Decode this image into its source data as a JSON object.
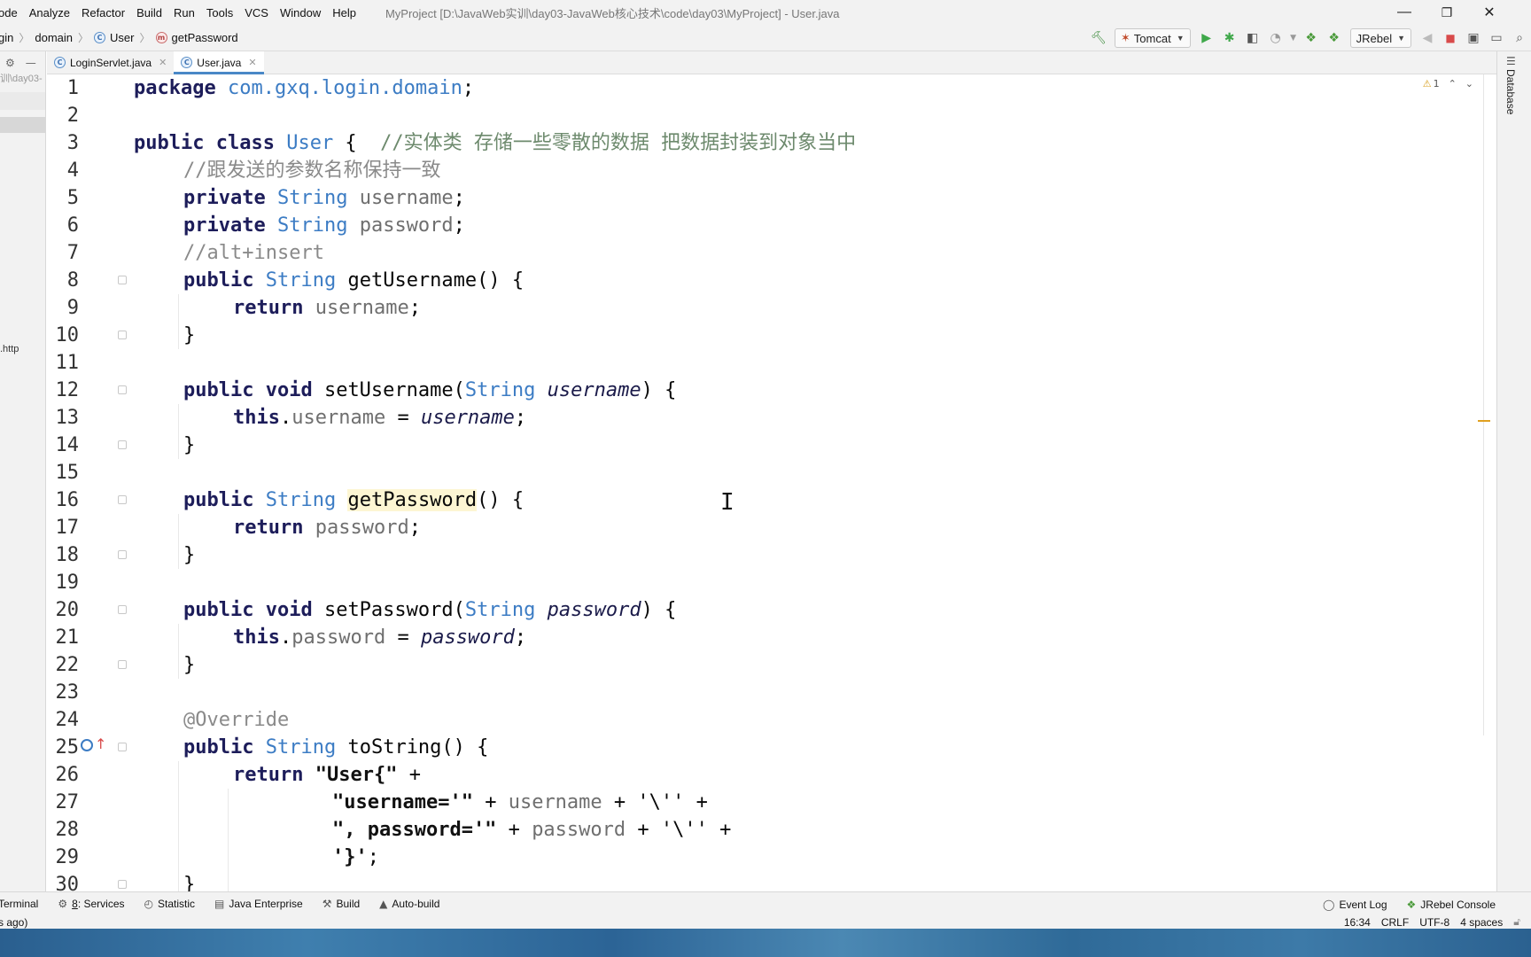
{
  "menu": {
    "items": [
      "ode",
      "Analyze",
      "Refactor",
      "Build",
      "Run",
      "Tools",
      "VCS",
      "Window",
      "Help"
    ],
    "title": "MyProject [D:\\JavaWeb实训\\day03-JavaWeb核心技术\\code\\day03\\MyProject] - User.java",
    "window_controls": [
      "—",
      "❐",
      "✕"
    ]
  },
  "breadcrumb": {
    "items": [
      "gin",
      "domain",
      "User",
      "getPassword"
    ]
  },
  "toolbar": {
    "run_config": "Tomcat",
    "jrebel": "JRebel"
  },
  "leftstrip": {
    "path_hint": "训\\day03-",
    "file_hint": ".http"
  },
  "tabs": [
    {
      "label": "LoginServlet.java",
      "active": false
    },
    {
      "label": "User.java",
      "active": true
    }
  ],
  "editor": {
    "warning_count": "1",
    "lines": [
      {
        "n": "1"
      },
      {
        "n": "2"
      },
      {
        "n": "3"
      },
      {
        "n": "4"
      },
      {
        "n": "5"
      },
      {
        "n": "6"
      },
      {
        "n": "7"
      },
      {
        "n": "8"
      },
      {
        "n": "9"
      },
      {
        "n": "10"
      },
      {
        "n": "11"
      },
      {
        "n": "12"
      },
      {
        "n": "13"
      },
      {
        "n": "14"
      },
      {
        "n": "15"
      },
      {
        "n": "16"
      },
      {
        "n": "17"
      },
      {
        "n": "18"
      },
      {
        "n": "19"
      },
      {
        "n": "20"
      },
      {
        "n": "21"
      },
      {
        "n": "22"
      },
      {
        "n": "23"
      },
      {
        "n": "24"
      },
      {
        "n": "25"
      },
      {
        "n": "26"
      },
      {
        "n": "27"
      },
      {
        "n": "28"
      },
      {
        "n": "29"
      },
      {
        "n": "30"
      }
    ],
    "code": {
      "l1_kw": "package",
      "l1_pkg": "com.gxq.login.domain",
      "l1_end": ";",
      "l3_kw": "public class",
      "l3_name": "User",
      "l3_brace": " {  ",
      "l3_comment": "//实体类 存储一些零散的数据 把数据封装到对象当中",
      "l4_comment": "//跟发送的参数名称保持一致",
      "l5_kw": "private",
      "l5_type": "String",
      "l5_field": "username",
      "l5_end": ";",
      "l6_kw": "private",
      "l6_type": "String",
      "l6_field": "password",
      "l6_end": ";",
      "l7_comment": "//alt+insert",
      "l8_kw": "public",
      "l8_type": "String",
      "l8_rest": " getUsername() {",
      "l9_kw": "return",
      "l9_field": "username",
      "l9_end": ";",
      "close_brace": "}",
      "l12_kw": "public void",
      "l12_name": " setUsername(",
      "l12_type": "String",
      "l12_param": "username",
      "l12_end": ") {",
      "l13_kw": "this",
      "l13_dot": ".",
      "l13_field": "username",
      "l13_eq": " = ",
      "l13_param": "username",
      "l13_end": ";",
      "l16_kw": "public",
      "l16_type": "String",
      "l16_name": "getPassword",
      "l16_rest": "() {",
      "l17_kw": "return",
      "l17_field": "password",
      "l17_end": ";",
      "l20_kw": "public void",
      "l20_name": " setPassword(",
      "l20_type": "String",
      "l20_param": "password",
      "l20_end": ") {",
      "l21_kw": "this",
      "l21_dot": ".",
      "l21_field": "password",
      "l21_eq": " = ",
      "l21_param": "password",
      "l21_end": ";",
      "l24_ann": "@Override",
      "l25_kw": "public",
      "l25_type": "String",
      "l25_rest": " toString() {",
      "l26_kw": "return",
      "l26_str": "\"User{\"",
      "l26_end": " +",
      "l27_str": "\"username='\"",
      "l27_op": " + ",
      "l27_field": "username",
      "l27_tail": " + '\\'' +",
      "l28_str": "\", password='\"",
      "l28_op": " + ",
      "l28_field": "password",
      "l28_tail": " + '\\'' +",
      "l29_str": "'}'",
      "l29_end": ";",
      "l30": "}"
    }
  },
  "rightstrip": {
    "label": "Database"
  },
  "bottom_tools": {
    "terminal": "Terminal",
    "services_num": "8",
    "services": ": Services",
    "statistic": "Statistic",
    "java_enterprise": "Java Enterprise",
    "build": "Build",
    "autobuild": "Auto-build",
    "event_log": "Event Log",
    "jrebel_console": "JRebel Console"
  },
  "status": {
    "left": "s ago)",
    "position": "16:34",
    "line_sep": "CRLF",
    "encoding": "UTF-8",
    "indent": "4 spaces"
  },
  "colors": {
    "keyword": "#1d1d5a",
    "type": "#3c7cc4",
    "comment": "#8a8a8a",
    "accent_tab": "#4a88c7",
    "run_green": "#3fa84a",
    "stop_red": "#d84a4a"
  }
}
